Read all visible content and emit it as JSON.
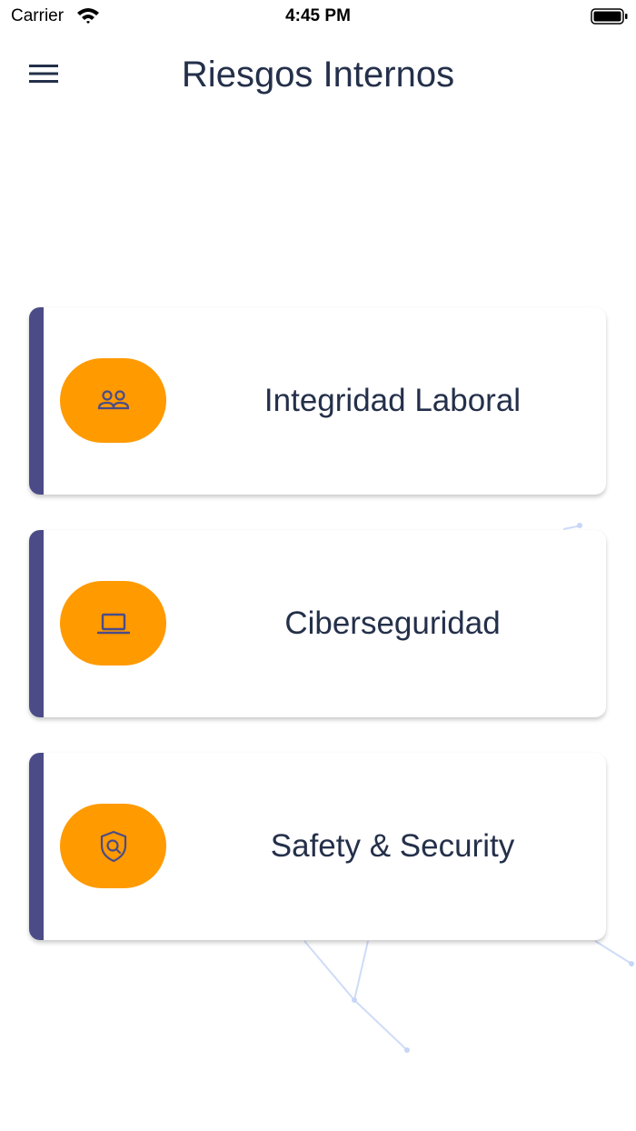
{
  "status_bar": {
    "carrier": "Carrier",
    "time": "4:45 PM",
    "wifi_icon": "wifi-icon",
    "battery_icon": "battery-icon"
  },
  "header": {
    "title": "Riesgos Internos",
    "menu_icon": "hamburger-menu-icon"
  },
  "colors": {
    "accent": "#4b4c87",
    "pill": "#ff9a00",
    "text": "#24304a"
  },
  "cards": [
    {
      "label": "Integridad Laboral",
      "icon": "people-icon"
    },
    {
      "label": "Ciberseguridad",
      "icon": "laptop-icon"
    },
    {
      "label": "Safety & Security",
      "icon": "shield-search-icon"
    }
  ]
}
